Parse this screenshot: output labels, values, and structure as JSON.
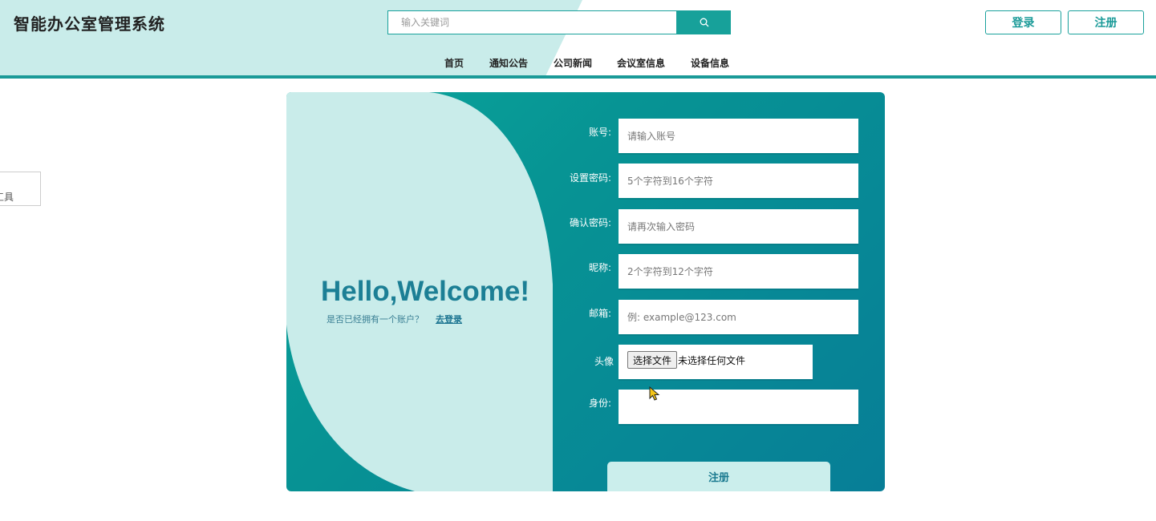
{
  "header": {
    "site_title": "智能办公室管理系统",
    "search_placeholder": "输入关键词",
    "login_label": "登录",
    "register_label": "注册",
    "nav": [
      {
        "label": "首页"
      },
      {
        "label": "通知公告"
      },
      {
        "label": "公司新闻"
      },
      {
        "label": "会议室信息"
      },
      {
        "label": "设备信息"
      }
    ]
  },
  "left_fragment": {
    "text": "工具"
  },
  "welcome": {
    "title": "Hello,Welcome!",
    "question": "是否已经拥有一个账户？",
    "login_link": "去登录"
  },
  "form": {
    "account_label": "账号:",
    "account_placeholder": "请输入账号",
    "password_label": "设置密码:",
    "password_placeholder": "5个字符到16个字符",
    "confirm_label": "确认密码:",
    "confirm_placeholder": "请再次输入密码",
    "nickname_label": "昵称:",
    "nickname_placeholder": "2个字符到12个字符",
    "email_label": "邮箱:",
    "email_placeholder": "例: example@123.com",
    "avatar_label": "头像",
    "file_button": "选择文件",
    "file_status": "未选择任何文件",
    "identity_label": "身份:",
    "identity_value": "",
    "submit_label": "注册"
  },
  "colors": {
    "accent": "#1a9a98",
    "header_tint": "#c9ecea",
    "card_gradient_start": "#0aa69b",
    "card_gradient_end": "#077e97",
    "panel_light": "#cbeeec"
  },
  "icons": {
    "search": "search-icon",
    "cursor": "mouse-pointer-icon"
  }
}
